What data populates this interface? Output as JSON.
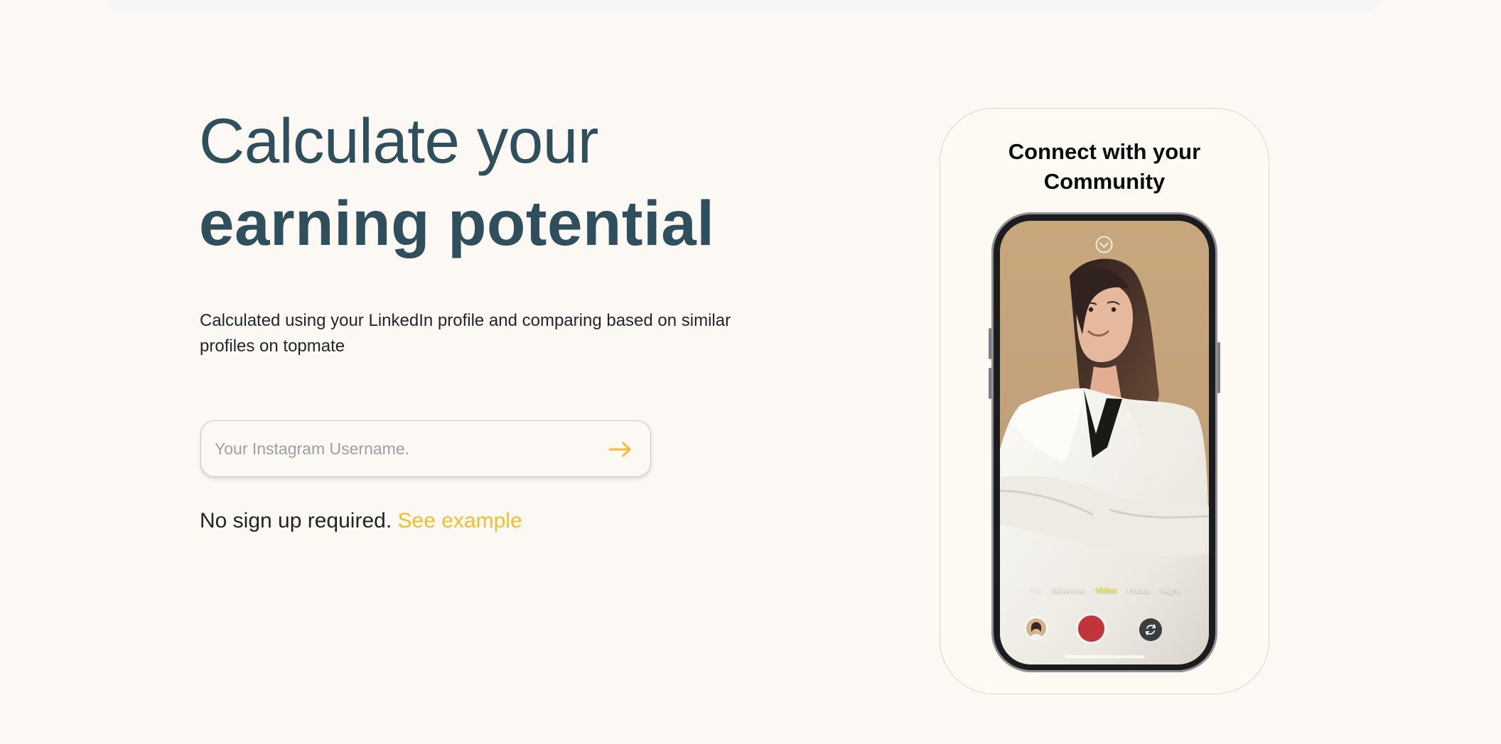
{
  "hero": {
    "title_line_1": "Calculate your",
    "title_line_2": "earning potential",
    "subtitle": "Calculated using your LinkedIn profile and comparing based on similar profiles on topmate"
  },
  "form": {
    "username_placeholder": "Your Instagram Username.",
    "username_value": "",
    "submit_icon": "arrow-right-icon",
    "accent_color": "#f3bd33"
  },
  "note": {
    "text": "No sign up required.",
    "link_text": "See example"
  },
  "phone_card": {
    "title_line_1": "Connect with your",
    "title_line_2": "Community",
    "camera_modes": [
      {
        "label": "Pro"
      },
      {
        "label": "Slow-mo"
      },
      {
        "label": "Video"
      },
      {
        "label": "Photo"
      },
      {
        "label": "Night"
      }
    ],
    "active_mode": "Video",
    "icons": {
      "top": "chevron-down-icon",
      "record": "record-button",
      "flip": "flip-camera-icon"
    }
  },
  "colors": {
    "background": "#fcf8f4",
    "headline": "#2f4f5c",
    "accent": "#f3bd33",
    "record": "#c2343c"
  }
}
